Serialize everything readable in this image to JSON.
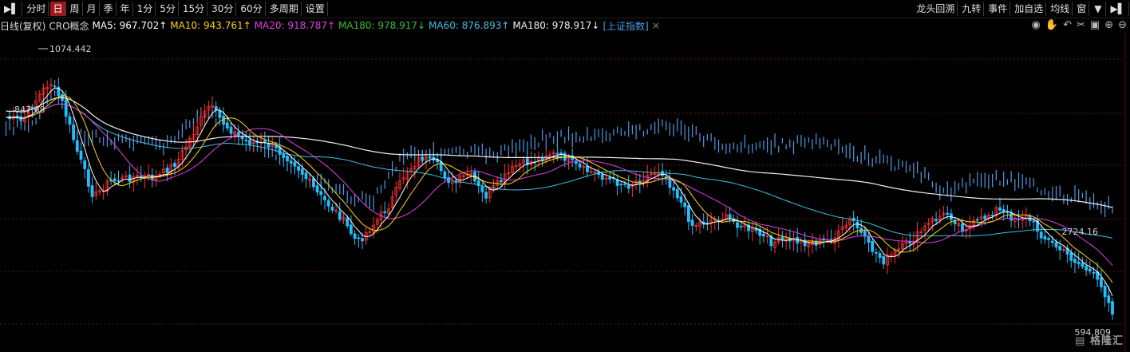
{
  "toolbar": {
    "left": [
      "分时",
      "日",
      "周",
      "月",
      "季",
      "年",
      "1分",
      "5分",
      "15分",
      "30分",
      "60分",
      "多周期",
      "设置"
    ],
    "active_index": 1,
    "right": [
      "龙头回溯",
      "九转",
      "事件",
      "加自选",
      "均线",
      "窗"
    ]
  },
  "info": {
    "period": "日线(复权)",
    "name": "CRO概念",
    "ma5": "MA5: 967.702↑",
    "ma10": "MA10: 943.761↑",
    "ma20": "MA20: 918.787↑",
    "ma180a": "MA180: 978.917↓",
    "ma60": "MA60: 876.893↑",
    "ma180b": "MA180: 978.917↓",
    "index_link": "[上证指数]",
    "close": "×"
  },
  "colors": {
    "ma5": "#ffffff",
    "ma10": "#ffd400",
    "ma20": "#e040e0",
    "ma180a": "#30c030",
    "ma60": "#40c0e0",
    "ma180b": "#f0f0f0",
    "up": "#ff3030",
    "down": "#20c0ff",
    "index": "#4a9be8"
  },
  "chart_data": {
    "type": "candlestick",
    "labels": {
      "high": "1074.442",
      "left": "847.68",
      "right": "2724.16",
      "low": "594.809"
    },
    "series": [
      {
        "name": "MA5"
      },
      {
        "name": "MA10"
      },
      {
        "name": "MA20"
      },
      {
        "name": "MA60"
      },
      {
        "name": "MA180"
      },
      {
        "name": "上证指数"
      }
    ]
  },
  "watermark": "格隆汇"
}
